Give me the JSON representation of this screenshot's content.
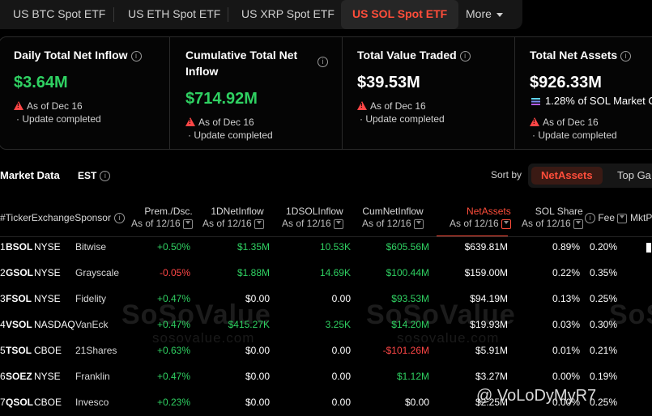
{
  "tabs": [
    {
      "label": "US BTC Spot ETF"
    },
    {
      "label": "US ETH Spot ETF"
    },
    {
      "label": "US XRP Spot ETF"
    },
    {
      "label": "US SOL Spot ETF"
    },
    {
      "label": "More"
    }
  ],
  "cards": [
    {
      "title": "Daily Total Net Inflow",
      "value": "$3.64M",
      "date": "As of Dec 16",
      "status": "· Update completed"
    },
    {
      "title1": "Cumulative Total Net",
      "title2": "Inflow",
      "value": "$714.92M",
      "date": "As of Dec 16",
      "status": "· Update completed"
    },
    {
      "title": "Total Value Traded",
      "value": "$39.53M",
      "date": "As of Dec 16",
      "status": "· Update completed"
    },
    {
      "title": "Total Net Assets",
      "value": "$926.33M",
      "share": "1.28% of SOL Market C",
      "date": "As of Dec 16",
      "status": "· Update completed"
    }
  ],
  "market": {
    "title": "Market Data",
    "tz": "EST",
    "sort_label": "Sort by",
    "sort_active": "NetAssets",
    "sort_other": "Top Ga"
  },
  "headers": {
    "ticker": "#TickerExchangeSponsor",
    "prem": "Prem./Dsc.",
    "prem_sub": "As of 12/16",
    "d1inflow": "1DNetInflow",
    "d1inflow_sub": "As of 12/16",
    "d1sol": "1DSOLInflow",
    "d1sol_sub": "As of 12/16",
    "cum": "CumNetInflow",
    "cum_sub": "As of 12/16",
    "assets": "NetAssets",
    "assets_sub": "As of 12/16",
    "share": "SOL Share",
    "share_sub": "As of 12/16",
    "fee": "Fee",
    "mkt": "MktP"
  },
  "rows": [
    {
      "idx": "1",
      "ticker": "BSOL",
      "exch": "NYSE",
      "sponsor": "Bitwise",
      "prem": "+0.50%",
      "d1": "$1.35M",
      "sol": "10.53K",
      "cum": "$605.56M",
      "assets": "$639.81M",
      "share": "0.89%",
      "fee": "0.20%"
    },
    {
      "idx": "2",
      "ticker": "GSOL",
      "exch": "NYSE",
      "sponsor": "Grayscale",
      "prem": "-0.05%",
      "d1": "$1.88M",
      "sol": "14.69K",
      "cum": "$100.44M",
      "assets": "$159.00M",
      "share": "0.22%",
      "fee": "0.35%"
    },
    {
      "idx": "3",
      "ticker": "FSOL",
      "exch": "NYSE",
      "sponsor": "Fidelity",
      "prem": "+0.47%",
      "d1": "$0.00",
      "sol": "0.00",
      "cum": "$93.53M",
      "assets": "$94.19M",
      "share": "0.13%",
      "fee": "0.25%"
    },
    {
      "idx": "4",
      "ticker": "VSOL",
      "exch": "NASDAQ",
      "sponsor": "VanEck",
      "prem": "+0.47%",
      "d1": "$415.27K",
      "sol": "3.25K",
      "cum": "$14.20M",
      "assets": "$19.93M",
      "share": "0.03%",
      "fee": "0.30%"
    },
    {
      "idx": "5",
      "ticker": "TSOL",
      "exch": "CBOE",
      "sponsor": "21Shares",
      "prem": "+0.63%",
      "d1": "$0.00",
      "sol": "0.00",
      "cum": "-$101.26M",
      "assets": "$5.91M",
      "share": "0.01%",
      "fee": "0.21%"
    },
    {
      "idx": "6",
      "ticker": "SOEZ",
      "exch": "NYSE",
      "sponsor": "Franklin",
      "prem": "+0.47%",
      "d1": "$0.00",
      "sol": "0.00",
      "cum": "$1.12M",
      "assets": "$3.27M",
      "share": "0.00%",
      "fee": "0.19%"
    },
    {
      "idx": "7",
      "ticker": "QSOL",
      "exch": "CBOE",
      "sponsor": "Invesco",
      "prem": "+0.23%",
      "d1": "$0.00",
      "sol": "0.00",
      "cum": "$0.00",
      "assets": "$2.25M",
      "share": "0.00%",
      "fee": "0.25%"
    }
  ],
  "watermark": {
    "brand": "SoSoValue",
    "url": "sosovalue.com"
  },
  "handle": "@ VoLoDyMyR7",
  "colors": {
    "accent": "#ff4d3a",
    "positive": "#2fd162",
    "negative": "#ff4646"
  }
}
